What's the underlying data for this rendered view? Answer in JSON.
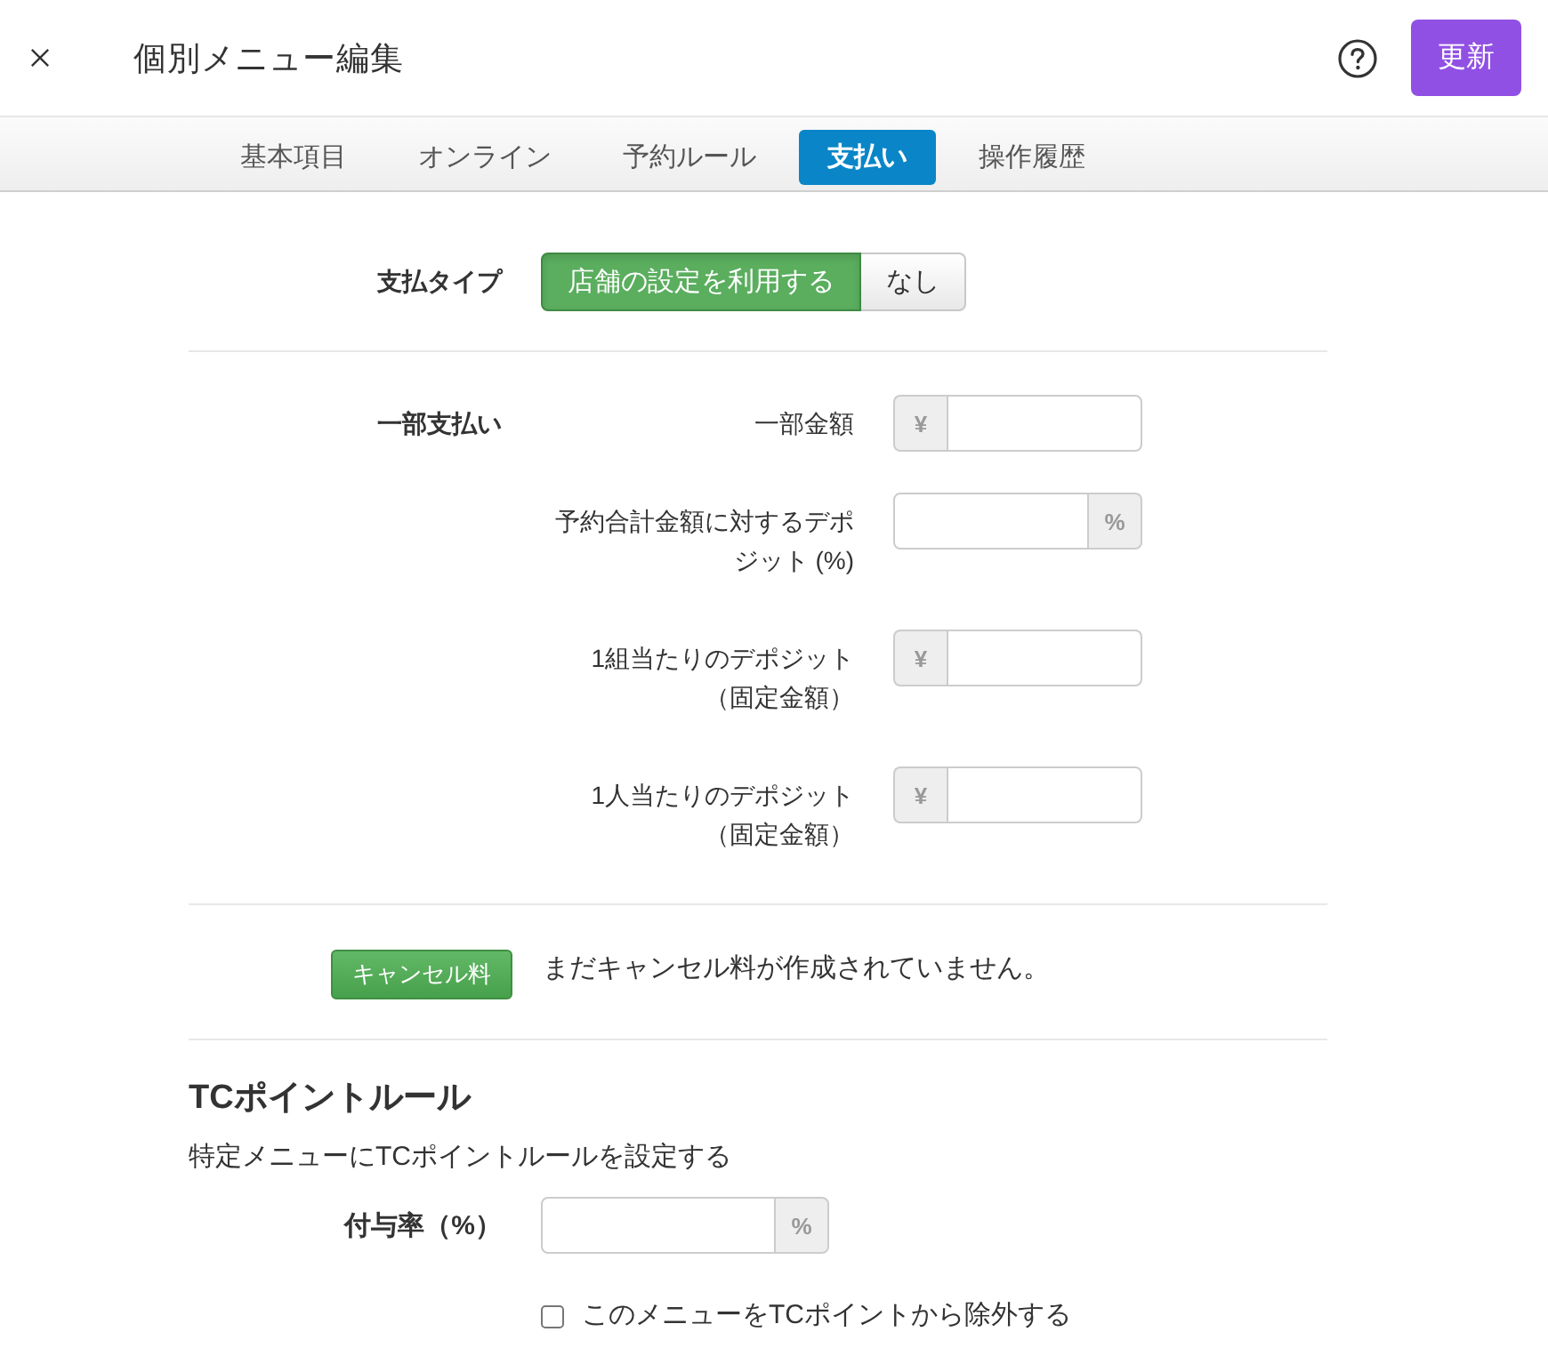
{
  "header": {
    "title": "個別メニュー編集",
    "update_button": "更新"
  },
  "tabs": [
    {
      "label": "基本項目",
      "selected": false
    },
    {
      "label": "オンライン",
      "selected": false
    },
    {
      "label": "予約ルール",
      "selected": false
    },
    {
      "label": "支払い",
      "selected": true
    },
    {
      "label": "操作履歴",
      "selected": false
    }
  ],
  "payment_type": {
    "label": "支払タイプ",
    "options": [
      {
        "label": "店舗の設定を利用する",
        "selected": true
      },
      {
        "label": "なし",
        "selected": false
      }
    ]
  },
  "partial_payment": {
    "label": "一部支払い",
    "fields": [
      {
        "label": "一部金額",
        "prefix": "¥"
      },
      {
        "label": "予約合計金額に対するデポジット (%)",
        "suffix": "%"
      },
      {
        "label": "1組当たりのデポジット（固定金額）",
        "prefix": "¥"
      },
      {
        "label": "1人当たりのデポジット（固定金額）",
        "prefix": "¥"
      }
    ]
  },
  "cancel_fee": {
    "button": "キャンセル料",
    "message": "まだキャンセル料が作成されていません。"
  },
  "tc_point_rule": {
    "title": "TCポイントルール",
    "description": "特定メニューにTCポイントルールを設定する",
    "rate": {
      "label": "付与率（%）",
      "suffix": "%"
    },
    "exclude_checkbox": {
      "label": "このメニューをTCポイントから除外する",
      "checked": false
    }
  }
}
